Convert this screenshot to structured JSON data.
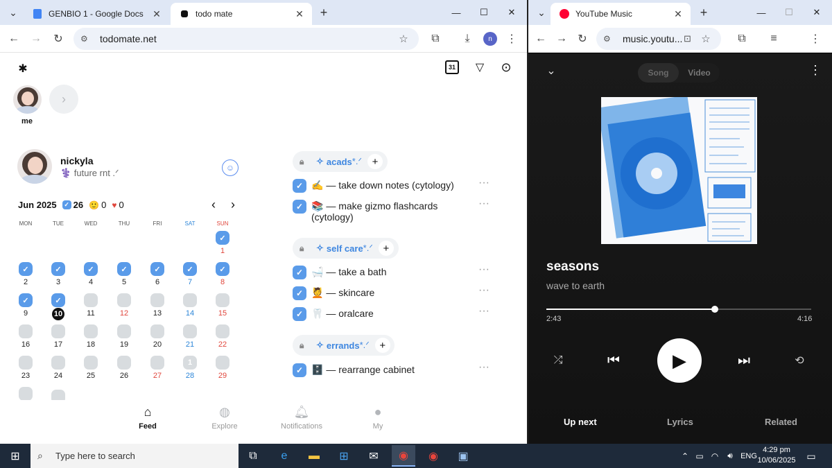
{
  "left_window": {
    "tabs": [
      {
        "title": "GENBIO 1 - Google Docs",
        "active": false,
        "icon": "docs-icon"
      },
      {
        "title": "todo mate",
        "active": true,
        "icon": "todomate-icon"
      }
    ],
    "url": "todomate.net",
    "profile_initial": "n"
  },
  "app": {
    "friends": [
      {
        "label": "me"
      }
    ],
    "profile": {
      "name": "nickyla",
      "bio": "⚕️ future rnt .ᐟ"
    },
    "calendar": {
      "month": "Jun 2025",
      "done_count": "26",
      "smile_count": "0",
      "heart_count": "0",
      "weekdays": [
        "MON",
        "TUE",
        "WED",
        "THU",
        "FRI",
        "SAT",
        "SUN"
      ],
      "today": 10,
      "done_days": [
        1,
        2,
        3,
        4,
        5,
        6,
        7,
        8,
        9,
        10
      ],
      "partial": {
        "28": "1"
      },
      "leading_blanks": 6,
      "days_in_month": 30
    },
    "categories": [
      {
        "name": "acads",
        "tasks": [
          {
            "text": "✍️ — take down notes (cytology)"
          },
          {
            "text": "📚 — make gizmo flashcards (cytology)"
          }
        ]
      },
      {
        "name": "self care",
        "tasks": [
          {
            "text": "🛁 — take a bath"
          },
          {
            "text": "💆 — skincare"
          },
          {
            "text": "🦷 — oralcare"
          }
        ]
      },
      {
        "name": "errands",
        "tasks": [
          {
            "text": "🗄️ — rearrange cabinet"
          }
        ]
      }
    ],
    "category_suffix": " *.ᐟ",
    "bottom_nav": [
      {
        "label": "Feed",
        "icon": "feed-icon",
        "active": true
      },
      {
        "label": "Explore",
        "icon": "explore-icon",
        "active": false
      },
      {
        "label": "Notifications",
        "icon": "bell-icon",
        "active": false
      },
      {
        "label": "My",
        "icon": "person-icon",
        "active": false
      }
    ]
  },
  "right_window": {
    "tab_title": "YouTube Music",
    "url": "music.youtu...",
    "toggle": {
      "song": "Song",
      "video": "Video"
    },
    "song_title": "seasons",
    "artist": "wave to earth",
    "elapsed": "2:43",
    "duration": "4:16",
    "progress_fraction": 0.637,
    "tabs": [
      {
        "label": "Up next",
        "active": true
      },
      {
        "label": "Lyrics",
        "active": false
      },
      {
        "label": "Related",
        "active": false
      }
    ]
  },
  "taskbar": {
    "search_placeholder": "Type here to search",
    "language": "ENG",
    "time": "4:29 pm",
    "date": "10/06/2025"
  },
  "colors": {
    "accent_blue": "#5a9be9",
    "category_blue": "#3d86e0",
    "weekend_red": "#e0463c",
    "weekend_blue": "#2d86d8"
  }
}
